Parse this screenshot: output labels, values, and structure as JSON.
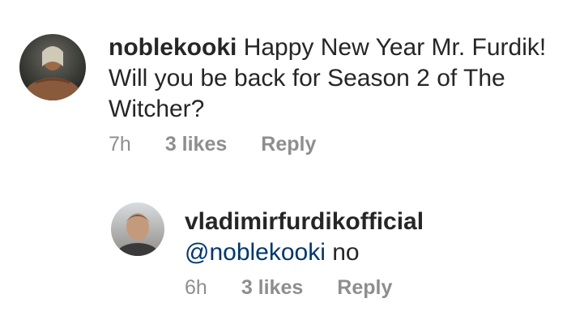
{
  "comments": [
    {
      "username": "noblekooki",
      "text": "Happy New Year Mr. Furdik! Will you be back for Season 2 of The Witcher?",
      "time": "7h",
      "likes": "3 likes",
      "reply_label": "Reply"
    },
    {
      "username": "vladimirfurdikofficial",
      "mention": "@noblekooki",
      "text": " no",
      "time": "6h",
      "likes": "3 likes",
      "reply_label": "Reply"
    }
  ]
}
